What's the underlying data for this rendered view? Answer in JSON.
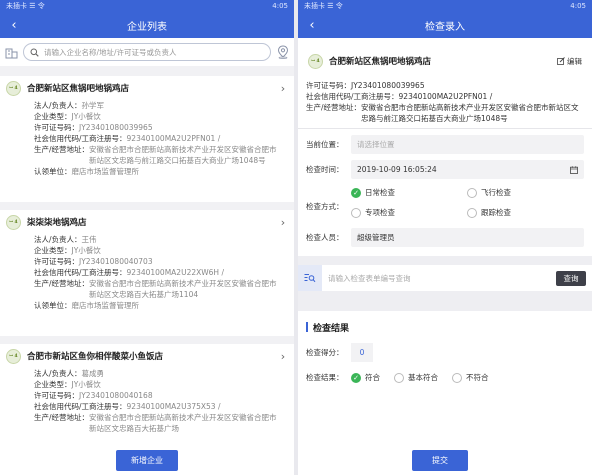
{
  "left": {
    "status_carrier": "未插卡 ☰ 令",
    "status_time": "4:05",
    "title": "企业列表",
    "search_placeholder": "请输入企业名称/地址/许可证号或负责人",
    "logo_text": "ꟷ 4",
    "labels": {
      "legal": "法人/负责人：",
      "type": "企业类型：",
      "license": "许可证号码：",
      "credit": "社会信用代码/工商注册号：",
      "address": "生产/经营地址：",
      "unit": "认领单位："
    },
    "cards": [
      {
        "name": "合肥新站区焦锅吧地锅鸡店",
        "legal": "孙学军",
        "type": "JY小餐饮",
        "license": "JY23401080039965",
        "credit": "92340100MA2U2PFN01 /",
        "address": "安徽省合肥市合肥新站高新技术产业开发区安徽省合肥市新站区文忠路与前江路交口拓基百大商业广场1048号",
        "unit": "磨店市场监督管理所"
      },
      {
        "name": "柒柒柒地锅鸡店",
        "legal": "王伟",
        "type": "JY小餐饮",
        "license": "JY23401080040703",
        "credit": "92340100MA2U22XW6H /",
        "address": "安徽省合肥市合肥新站高新技术产业开发区安徽省合肥市新站区文忠路百大拓基广场1104",
        "unit": "磨店市场监督管理所"
      },
      {
        "name": "合肥市新站区鱼你相伴酸菜小鱼饭店",
        "legal": "葛成勇",
        "type": "JY小餐饮",
        "license": "JY23401080040168",
        "credit": "92340100MA2U375X53 /",
        "address": "安徽省合肥市合肥新站高新技术产业开发区安徽省合肥市新站区文忠路百大拓基广场",
        "unit": ""
      }
    ],
    "add_button": "新增企业"
  },
  "right": {
    "status_carrier": "未插卡 ☰ 令",
    "status_time": "4:05",
    "title": "检查录入",
    "company_name": "合肥新站区焦锅吧地锅鸡店",
    "edit_label": "编辑",
    "license_label": "许可证号码：",
    "license": "JY23401080039965",
    "credit_label": "社会信用代码/工商注册号：",
    "credit": "92340100MA2U2PFN01 /",
    "address_label": "生产/经营地址：",
    "address": "安徽省合肥市合肥新站高新技术产业开发区安徽省合肥市新站区文忠路与前江路交口拓基百大商业广场1048号",
    "location_label": "当前位置：",
    "location_placeholder": "请选择位置",
    "time_label": "检查时间：",
    "time_value": "2019-10-09 16:05:24",
    "method_label": "检查方式：",
    "methods": [
      "日常检查",
      "飞行检查",
      "专项检查",
      "跟踪检查"
    ],
    "inspector_label": "检查人员：",
    "inspector": "超级管理员",
    "query_placeholder": "请输入检查表单编号查询",
    "query_button": "查询",
    "result_title": "检查结果",
    "score_label": "检查得分：",
    "score": "0",
    "result_label": "检查结果：",
    "results": [
      "符合",
      "基本符合",
      "不符合"
    ],
    "submit": "提交"
  }
}
